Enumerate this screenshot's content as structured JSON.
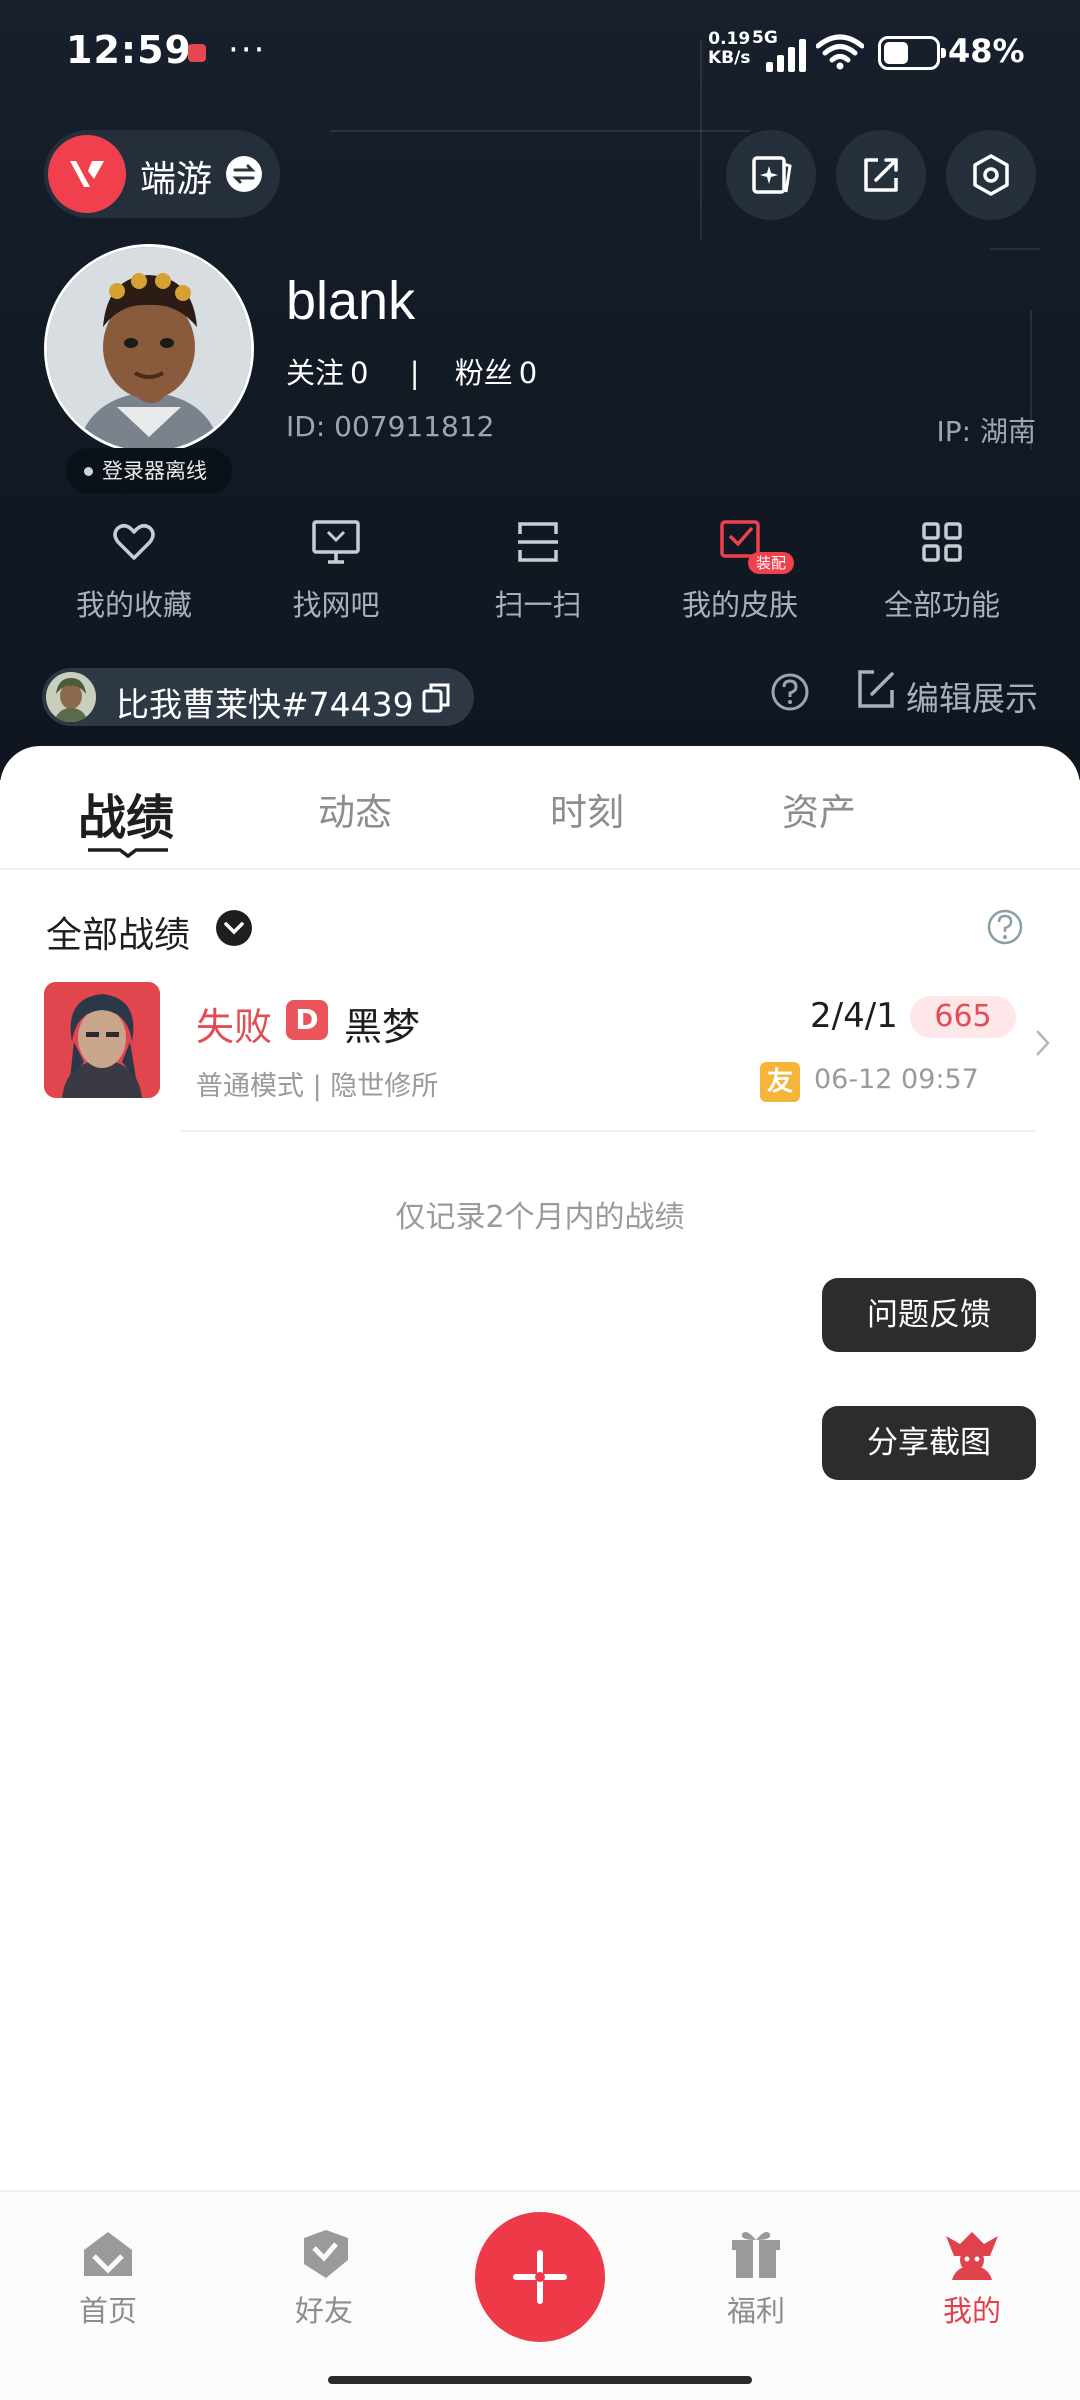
{
  "status_bar": {
    "time": "12:59",
    "more": "···",
    "speed_value": "0.19",
    "speed_unit": "KB/s",
    "network": "5G",
    "battery_percent": 48,
    "battery_text": "48%"
  },
  "header": {
    "game_name": "端游",
    "username": "blank",
    "follow_label": "关注",
    "follow_count": "0",
    "fans_label": "粉丝",
    "fans_count": "0",
    "id_text": "ID: 007911812",
    "ip_text": "IP: 湖南",
    "status_badge": "登录器离线"
  },
  "functions": [
    {
      "label": "我的收藏",
      "icon": "heart-icon"
    },
    {
      "label": "找网吧",
      "icon": "monitor-icon"
    },
    {
      "label": "扫一扫",
      "icon": "scan-icon"
    },
    {
      "label": "我的皮肤",
      "icon": "skin-icon",
      "tag": "装配"
    },
    {
      "label": "全部功能",
      "icon": "grid-icon"
    }
  ],
  "player_tag": {
    "name": "比我曹莱快#74439",
    "edit_label": "编辑展示"
  },
  "tabs": [
    {
      "label": "战绩",
      "active": true
    },
    {
      "label": "动态",
      "active": false
    },
    {
      "label": "时刻",
      "active": false
    },
    {
      "label": "资产",
      "active": false
    }
  ],
  "filter_label": "全部战绩",
  "match": {
    "result": "失败",
    "rank": "D",
    "map": "黑梦",
    "kda": "2/4/1",
    "score": "665",
    "mode": "普通模式 | 隐世修所",
    "friend_tag": "友",
    "time": "06-12 09:57"
  },
  "note": "仅记录2个月内的战绩",
  "buttons": {
    "feedback": "问题反馈",
    "share": "分享截图"
  },
  "bottom_nav": [
    {
      "label": "首页",
      "icon": "home-icon",
      "active": false
    },
    {
      "label": "好友",
      "icon": "friends-icon",
      "active": false
    },
    {
      "label": "福利",
      "icon": "gift-icon",
      "active": false
    },
    {
      "label": "我的",
      "icon": "profile-icon",
      "active": true
    }
  ],
  "colors": {
    "accent": "#ee3a48",
    "header_bg": "#141c27",
    "loss_red": "#e24d55",
    "friend_orange": "#f5b53b"
  }
}
